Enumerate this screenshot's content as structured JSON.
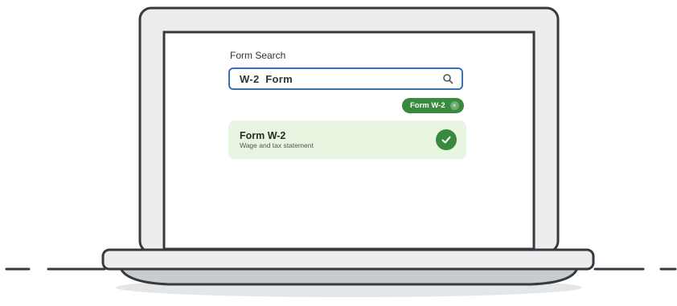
{
  "search": {
    "label": "Form Search",
    "value": "W-2  Form",
    "placeholder": ""
  },
  "chip": {
    "label": "Form W-2",
    "close_glyph": "×"
  },
  "result": {
    "title": "Form W-2",
    "subtitle": "Wage and tax statement"
  },
  "icons": {
    "search": "search-icon",
    "check": "check-icon",
    "close": "close-icon"
  },
  "colors": {
    "accent_green": "#3a8a3e",
    "input_border": "#3d6fb5",
    "result_bg": "#e8f5e1",
    "laptop_outline": "#333a40",
    "laptop_fill": "#ededed",
    "base_shadow": "#c8ccd1"
  }
}
